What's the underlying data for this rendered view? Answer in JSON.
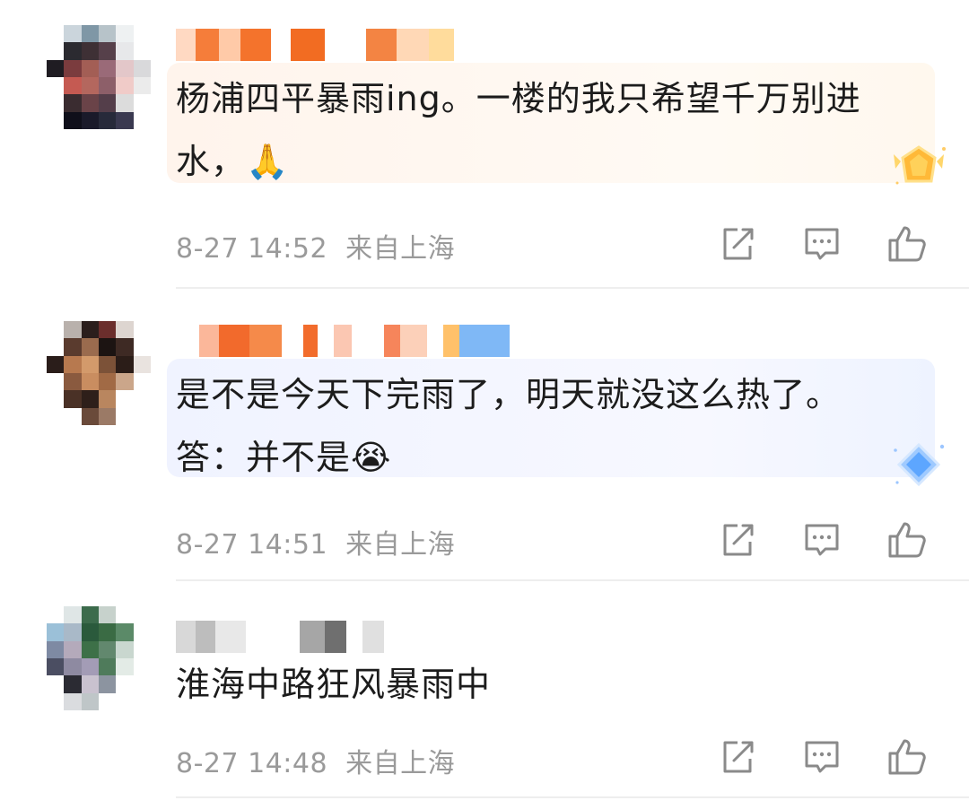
{
  "comments": [
    {
      "text": "杨浦四平暴雨ing。一楼的我只希望千万别进水，🙏",
      "time": "8-27 14:52",
      "location": "来自上海",
      "bubble_colors": [
        "#fff5ee",
        "#fffaf3"
      ],
      "badge": "gold-badge-icon"
    },
    {
      "text": "是不是今天下完雨了，明天就没这么热了。答：并不是😭",
      "time": "8-27 14:51",
      "location": "来自上海",
      "bubble_colors": [
        "#eef3ff",
        "#f7f9ff"
      ],
      "badge": "diamond-badge-icon"
    },
    {
      "text": "淮海中路狂风暴雨中",
      "time": "8-27 14:48",
      "location": "来自上海"
    }
  ],
  "icons": [
    "share-icon",
    "comment-icon",
    "like-icon"
  ]
}
